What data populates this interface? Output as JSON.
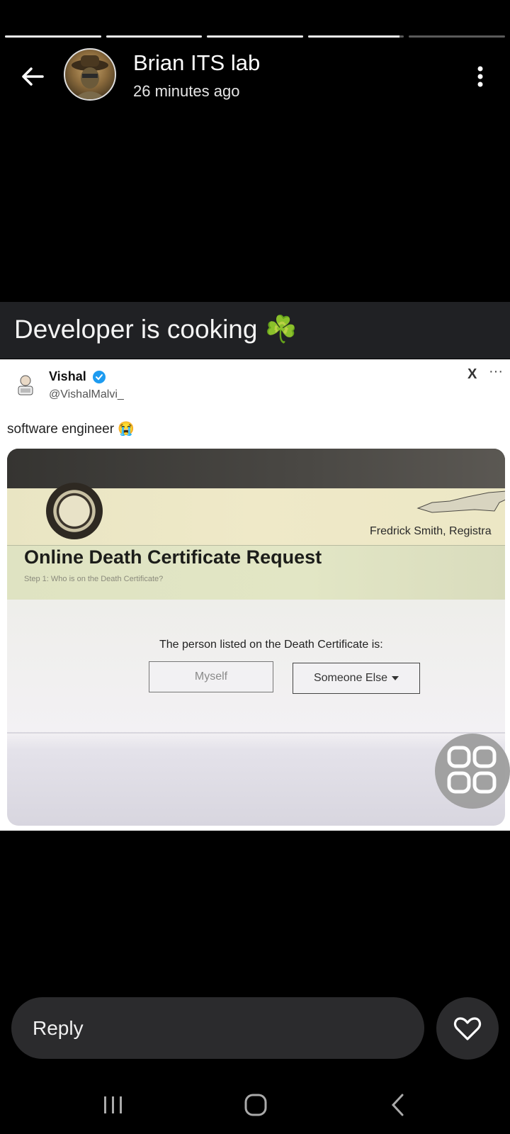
{
  "story": {
    "progress": [
      1,
      1,
      1,
      0.95,
      0
    ],
    "user_name": "Brian ITS lab",
    "time_ago": "26 minutes ago",
    "caption": "Developer is cooking ☘️"
  },
  "tweet": {
    "name": "Vishal",
    "handle": "@VishalMalvi_",
    "text": "software engineer 😭",
    "platform_mark": "X",
    "menu": "···"
  },
  "photo": {
    "registrar": "Fredrick Smith, Registra",
    "heading": "Online Death Certificate Request",
    "step": "Step 1: Who is on the Death Certificate?",
    "question": "The person listed on the Death Certificate is:",
    "option_myself": "Myself",
    "option_someone_else": "Someone Else"
  },
  "reply": {
    "label": "Reply"
  },
  "colors": {
    "background": "#000000",
    "caption_bar": "#202124",
    "reply_bar": "#2b2b2d",
    "verified": "#1d9bf0"
  },
  "icons": [
    "back-arrow-icon",
    "more-vertical-icon",
    "verified-badge-icon",
    "heart-icon",
    "recent-apps-icon",
    "home-icon",
    "nav-back-icon"
  ]
}
